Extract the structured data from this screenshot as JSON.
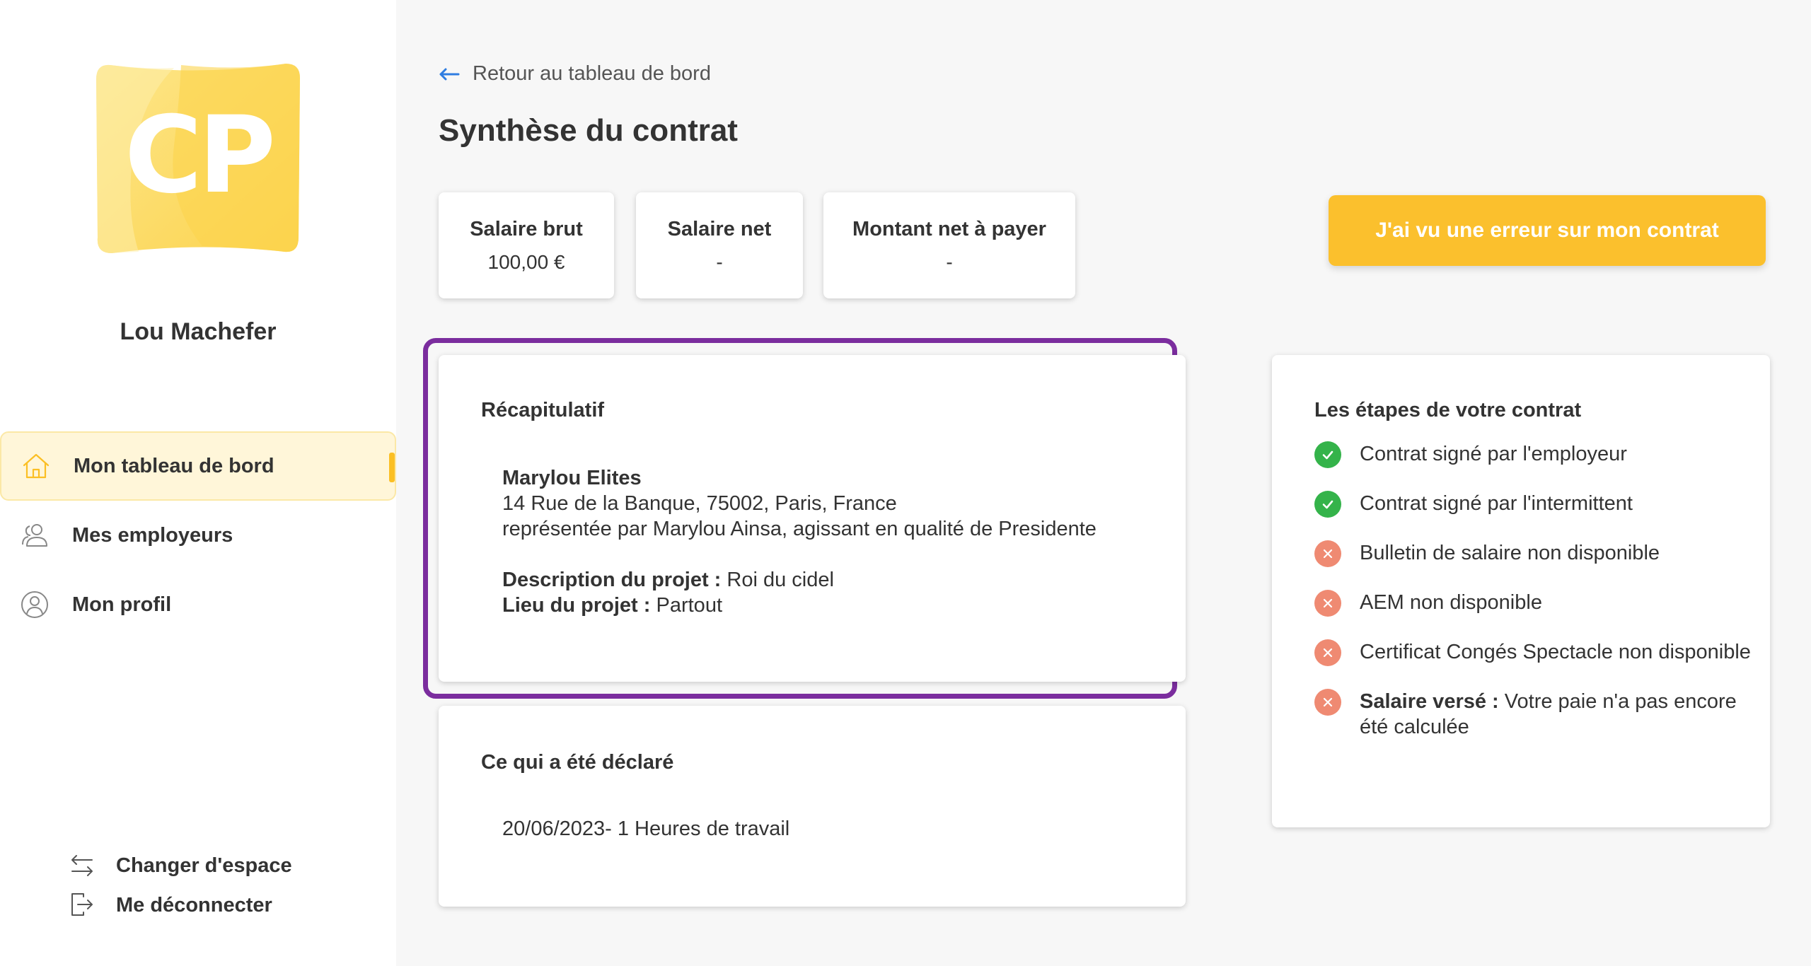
{
  "sidebar": {
    "logo_text": "CP",
    "user_name": "Lou Machefer",
    "nav": [
      {
        "label": "Mon tableau de bord",
        "icon": "home-icon",
        "active": true
      },
      {
        "label": "Mes employeurs",
        "icon": "users-icon",
        "active": false
      },
      {
        "label": "Mon profil",
        "icon": "user-circle-icon",
        "active": false
      }
    ],
    "bottom": {
      "switch_label": "Changer d'espace",
      "logout_label": "Me déconnecter"
    }
  },
  "main": {
    "back_label": "Retour au tableau de bord",
    "title": "Synthèse du contrat",
    "stats": [
      {
        "label": "Salaire brut",
        "value": "100,00 €"
      },
      {
        "label": "Salaire net",
        "value": "-"
      },
      {
        "label": "Montant net à payer",
        "value": "-"
      }
    ],
    "error_button_label": "J'ai vu une erreur sur mon contrat",
    "recap": {
      "title": "Récapitulatif",
      "company": "Marylou Elites",
      "address": "14 Rue de la Banque, 75002, Paris, France",
      "representative": "représentée par Marylou Ainsa, agissant en qualité de Presidente",
      "description_label": "Description du projet :",
      "description_value": "Roi du cidel",
      "location_label": "Lieu du projet :",
      "location_value": "Partout"
    },
    "declared": {
      "title": "Ce qui a été déclaré",
      "line": "20/06/2023- 1 Heures de travail"
    },
    "steps": {
      "title": "Les étapes de votre contrat",
      "items": [
        {
          "status": "done",
          "text": "Contrat signé par l'employeur"
        },
        {
          "status": "done",
          "text": "Contrat signé par l'intermittent"
        },
        {
          "status": "missing",
          "text": "Bulletin de salaire non disponible"
        },
        {
          "status": "missing",
          "text": "AEM non disponible"
        },
        {
          "status": "missing",
          "text": "Certificat Congés Spectacle non disponible"
        },
        {
          "status": "missing",
          "label": "Salaire versé :",
          "text": "Votre paie n'a pas encore été calculée"
        }
      ]
    }
  },
  "colors": {
    "accent": "#fbc02d",
    "highlight": "#7b2d9e",
    "success": "#34b34a",
    "error": "#ef8a72"
  }
}
